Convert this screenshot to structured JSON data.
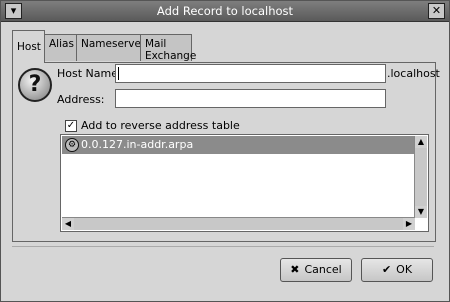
{
  "window": {
    "title": "Add Record to localhost"
  },
  "titlebar": {
    "left_button": "▾",
    "right_button": "✕"
  },
  "tabs": [
    {
      "label": "Host",
      "active": true
    },
    {
      "label": "Alias",
      "active": false
    },
    {
      "label": "Nameserver",
      "active": false
    },
    {
      "label": "Mail Exchange",
      "active": false
    }
  ],
  "form": {
    "host_name_label": "Host Name:",
    "host_name_value": "",
    "domain_suffix": ".localhost",
    "address_label": "Address:",
    "address_value": ""
  },
  "reverse": {
    "checkbox_checked": true,
    "checkbox_label": "Add to reverse address table",
    "items": [
      "0.0.127.in-addr.arpa"
    ]
  },
  "buttons": {
    "cancel": "Cancel",
    "ok": "OK"
  },
  "icons": {
    "help": "question-mark-icon",
    "zone": "zone-icon",
    "cancel": "x-icon",
    "ok": "checkmark-icon"
  }
}
